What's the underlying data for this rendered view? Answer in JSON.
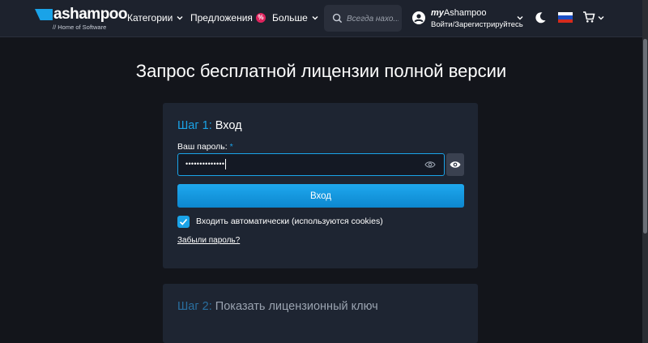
{
  "header": {
    "logo": {
      "name": "ashampoo",
      "tagline": "// Home of Software"
    },
    "nav": [
      {
        "label": "Категории",
        "has_dropdown": true
      },
      {
        "label": "Предложения",
        "badge": "%",
        "has_dropdown": false
      },
      {
        "label": "Больше",
        "has_dropdown": true
      }
    ],
    "search": {
      "placeholder": "Всегда нахо..."
    },
    "account": {
      "brand_prefix": "my",
      "brand_name": "Ashampoo",
      "links": "Войти/Зарегистрируйтесь"
    },
    "icons": [
      "user-icon",
      "moon-icon",
      "russia-flag-icon",
      "cart-icon"
    ]
  },
  "page": {
    "title": "Запрос бесплатной лицензии полной версии"
  },
  "step1": {
    "number": "Шаг 1:",
    "title": "Вход",
    "password_label": "Ваш пароль:",
    "required_mark": "*",
    "password_mask": "••••••••••••••",
    "login_button": "Вход",
    "remember_checked": true,
    "remember_label": "Входить автоматически (используются cookies)",
    "forgot_link": "Забыли пароль?"
  },
  "step2": {
    "number": "Шаг 2:",
    "title": "Показать лицензионный ключ"
  },
  "colors": {
    "accent": "#1aa3e8",
    "background": "#13151b",
    "card": "#1e2532",
    "header": "#1d222d",
    "badge": "#e0245e"
  }
}
